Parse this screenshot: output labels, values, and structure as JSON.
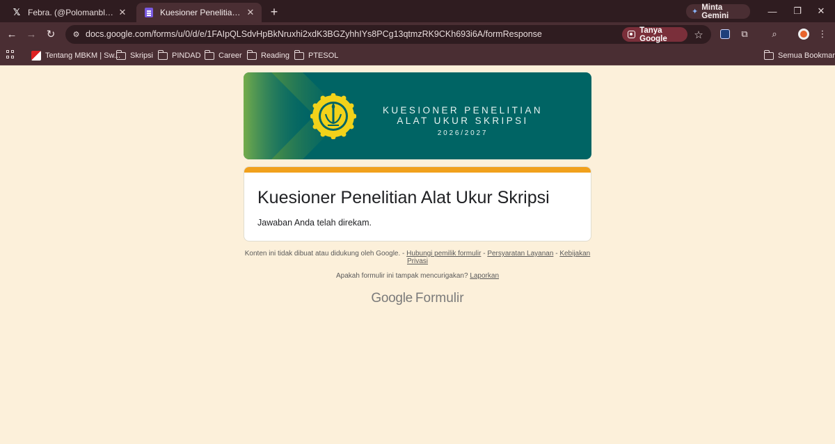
{
  "browser": {
    "tabs": [
      {
        "title": "Febra. (@Polomanbleu) / X",
        "icon": "x-logo-icon",
        "active": false
      },
      {
        "title": "Kuesioner Penelitian Alat Ukur Skripsi",
        "icon": "google-forms-icon",
        "active": true
      }
    ],
    "close_glyph": "✕",
    "new_tab_glyph": "+",
    "gemini_label": "Minta Gemini",
    "window_controls": {
      "minimize": "—",
      "restore": "❐",
      "close": "✕"
    },
    "url": "docs.google.com/forms/u/0/d/e/1FAIpQLSdvHpBkNruxhi2xdK3BGZyhhIYs8PCg13qtmzRK9CKh693i6A/formResponse",
    "tanya_google_label": "Tanya Google",
    "nav": {
      "back": "←",
      "forward": "→",
      "reload": "↻",
      "star": "☆"
    },
    "bookmarks": [
      {
        "label": "Tentang MBKM | Sw...",
        "icon": "mbkm-favicon"
      },
      {
        "label": "Skripsi",
        "icon": "folder-icon"
      },
      {
        "label": "PINDAD",
        "icon": "folder-icon"
      },
      {
        "label": "Career",
        "icon": "folder-icon"
      },
      {
        "label": "Reading",
        "icon": "folder-icon"
      },
      {
        "label": "PTESOL",
        "icon": "folder-icon"
      }
    ],
    "all_bookmarks_label": "Semua Bookmark"
  },
  "banner": {
    "line1": "KUESIONER PENELITIAN",
    "line2": "ALAT UKUR SKRIPSI",
    "year": "2026/2027",
    "logo_text": "UNIVERSITAS NEGERI JAKARTA",
    "colors": {
      "background": "#006464",
      "logo_yellow": "#f2d21a",
      "chevron_green": "#7ab04a"
    }
  },
  "form": {
    "title": "Kuesioner Penelitian Alat Ukur Skripsi",
    "response_message": "Jawaban Anda telah direkam.",
    "accent_color": "#f1a11c"
  },
  "footer": {
    "disclaimer_prefix": "Konten ini tidak dibuat atau didukung oleh Google. -",
    "link_contact_owner": "Hubungi pemilik formulir",
    "sep1": "-",
    "link_terms": "Persyaratan Layanan",
    "sep2": "-",
    "link_privacy": "Kebijakan Privasi",
    "suspicious_text": "Apakah formulir ini tampak mencurigakan?",
    "link_report": "Laporkan",
    "logo_google": "Google",
    "logo_formulir": "Formulir"
  },
  "colors": {
    "page_background": "#fcf0da",
    "chrome_dark": "#2f1c20",
    "chrome_mid": "#4a2e33"
  }
}
